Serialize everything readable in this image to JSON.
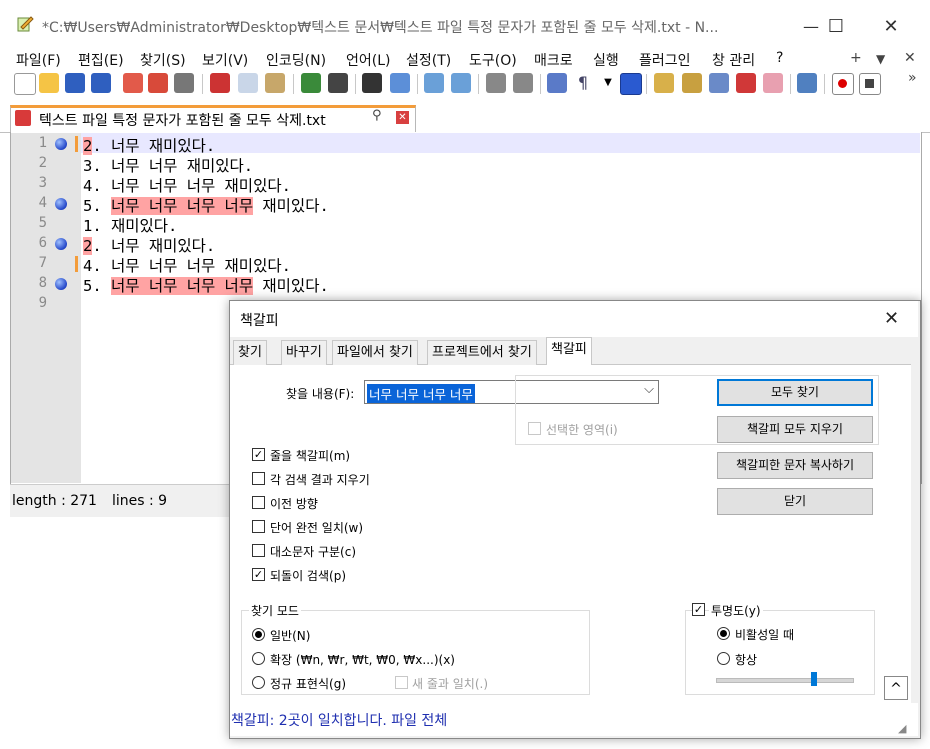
{
  "window": {
    "title": "*C:₩Users₩Administrator₩Desktop₩텍스트 문서₩텍스트 파일 특정 문자가 포함된 줄 모두 삭제.txt - N...",
    "minimize": "—",
    "maximize": "☐",
    "close": "✕"
  },
  "menu": {
    "items": [
      "파일(F)",
      "편집(E)",
      "찾기(S)",
      "보기(V)",
      "인코딩(N)",
      "언어(L)",
      "설정(T)",
      "도구(O)",
      "매크로",
      "실행",
      "플러그인",
      "창 관리",
      "?"
    ],
    "extra": [
      "+",
      "▼",
      "✕"
    ]
  },
  "toolbar": {
    "overflow": "»"
  },
  "tab": {
    "label": "텍스트 파일 특정 문자가 포함된 줄 모두 삭제.txt",
    "pin": "📌",
    "close": "✕"
  },
  "editor": {
    "lines": [
      {
        "num": "1",
        "bookmark": true,
        "changed": true,
        "pre": "",
        "hl": "2",
        "post": ". 너무 재미있다."
      },
      {
        "num": "2",
        "bookmark": false,
        "changed": false,
        "pre": "3. 너무 너무 재미있다.",
        "hl": "",
        "post": ""
      },
      {
        "num": "3",
        "bookmark": false,
        "changed": false,
        "pre": "4. 너무 너무 너무 재미있다.",
        "hl": "",
        "post": ""
      },
      {
        "num": "4",
        "bookmark": true,
        "changed": false,
        "pre": "5. ",
        "hl": "너무 너무 너무 너무",
        "post": " 재미있다."
      },
      {
        "num": "5",
        "bookmark": false,
        "changed": false,
        "pre": "1. 재미있다.",
        "hl": "",
        "post": ""
      },
      {
        "num": "6",
        "bookmark": true,
        "changed": false,
        "pre": "",
        "hl": "2",
        "post": ". 너무 재미있다."
      },
      {
        "num": "7",
        "bookmark": false,
        "changed": true,
        "pre": "4. 너무 너무 너무 재미있다.",
        "hl": "",
        "post": ""
      },
      {
        "num": "8",
        "bookmark": true,
        "changed": false,
        "pre": "5. ",
        "hl": "너무 너무 너무 너무",
        "post": " 재미있다."
      },
      {
        "num": "9",
        "bookmark": false,
        "changed": false,
        "pre": "",
        "hl": "",
        "post": ""
      }
    ]
  },
  "status": {
    "length": "length : 271",
    "lines": "lines : 9"
  },
  "dialog": {
    "title": "책갈피",
    "close": "✕",
    "tabs": [
      "찾기",
      "바꾸기",
      "파일에서 찾기",
      "프로젝트에서 찾기",
      "책갈피"
    ],
    "find_label": "찾을 내용(F):",
    "find_value": "너무 너무 너무 너무",
    "in_selection": "선택한 영역(i)",
    "buttons": {
      "find_all": "모두 찾기",
      "clear_bookmarks": "책갈피 모두 지우기",
      "copy_bookmarked": "책갈피한 문자 복사하기",
      "close": "닫기"
    },
    "options": [
      {
        "label": "줄을 책갈피(m)",
        "checked": true
      },
      {
        "label": "각 검색 결과 지우기",
        "checked": false
      },
      {
        "label": "이전 방향",
        "checked": false
      },
      {
        "label": "단어 완전 일치(w)",
        "checked": false
      },
      {
        "label": "대소문자 구분(c)",
        "checked": false
      },
      {
        "label": "되돌이 검색(p)",
        "checked": true
      }
    ],
    "search_mode": {
      "title": "찾기 모드",
      "normal": "일반(N)",
      "extended": "확장 (₩n, ₩r, ₩t, ₩0, ₩x...)(x)",
      "regex": "정규 표현식(g)",
      "dot_newline": "새 줄과 일치(.)",
      "selected": "normal"
    },
    "transparency": {
      "label": "투명도(y)",
      "checked": true,
      "on_lose_focus": "비활성일 때",
      "always": "항상",
      "selected": "on_lose_focus",
      "level": 0.72
    },
    "status_text": "책갈피: 2곳이 일치합니다. 파일 전체",
    "scroll_up": "^"
  },
  "colors": {
    "accent_tab": "#f39c3a",
    "highlight": "#ffa3a3",
    "status_blue": "#1f2fb0"
  }
}
